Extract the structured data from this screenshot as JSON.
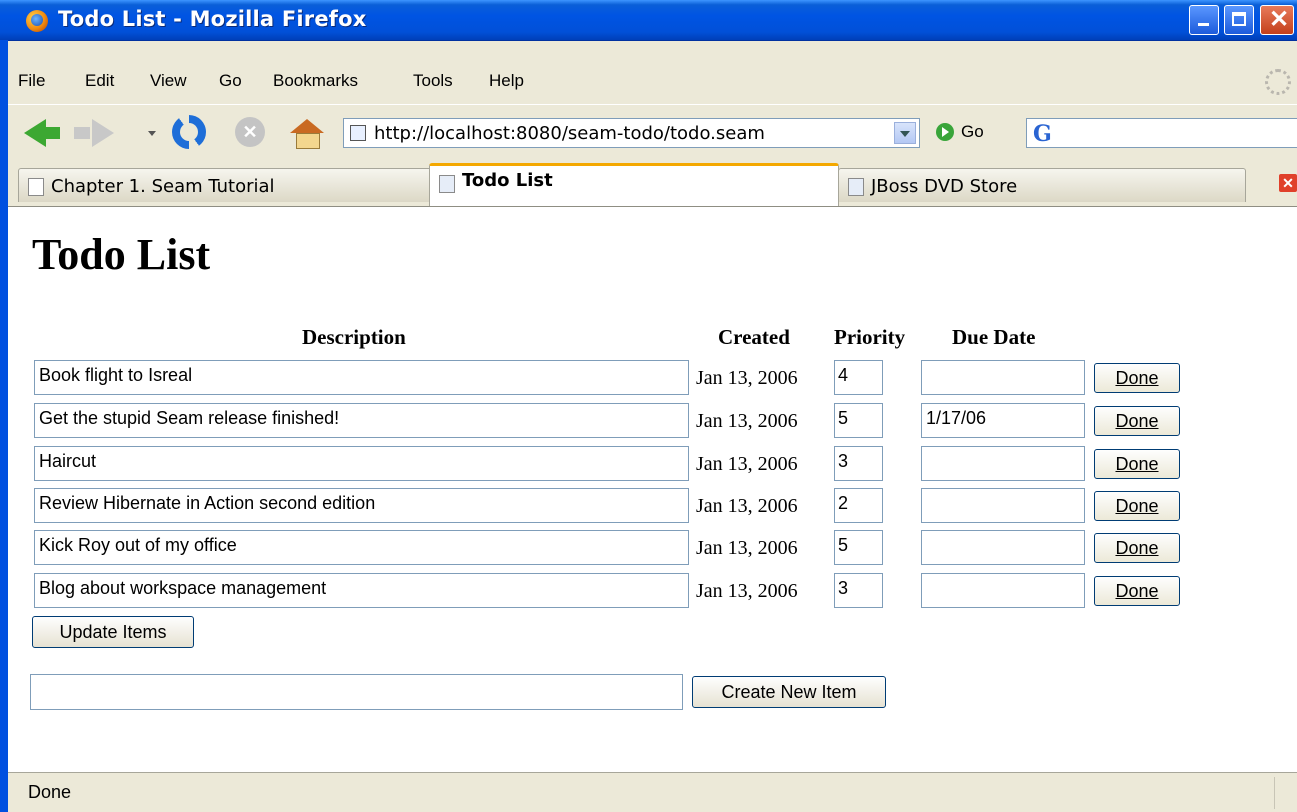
{
  "window": {
    "title": "Todo List - Mozilla Firefox"
  },
  "menu": [
    "File",
    "Edit",
    "View",
    "Go",
    "Bookmarks",
    "Tools",
    "Help"
  ],
  "nav": {
    "url": "http://localhost:8080/seam-todo/todo.seam",
    "go_label": "Go",
    "search_value": ""
  },
  "tabs": [
    {
      "label": "Chapter 1. Seam Tutorial",
      "active": false
    },
    {
      "label": "Todo List",
      "active": true
    },
    {
      "label": "JBoss DVD Store",
      "active": false
    }
  ],
  "page": {
    "title": "Todo List",
    "headers": {
      "description": "Description",
      "created": "Created",
      "priority": "Priority",
      "due_date": "Due Date"
    },
    "items": [
      {
        "description": "Book flight to Isreal",
        "created": "Jan 13, 2006",
        "priority": "4",
        "due_date": "",
        "action": "Done"
      },
      {
        "description": "Get the stupid Seam release finished!",
        "created": "Jan 13, 2006",
        "priority": "5",
        "due_date": "1/17/06",
        "action": "Done"
      },
      {
        "description": "Haircut",
        "created": "Jan 13, 2006",
        "priority": "3",
        "due_date": "",
        "action": "Done"
      },
      {
        "description": "Review Hibernate in Action second edition",
        "created": "Jan 13, 2006",
        "priority": "2",
        "due_date": "",
        "action": "Done"
      },
      {
        "description": "Kick Roy out of my office",
        "created": "Jan 13, 2006",
        "priority": "5",
        "due_date": "",
        "action": "Done"
      },
      {
        "description": "Blog about workspace management",
        "created": "Jan 13, 2006",
        "priority": "3",
        "due_date": "",
        "action": "Done"
      }
    ],
    "update_label": "Update Items",
    "new_item_value": "",
    "create_label": "Create New Item"
  },
  "status": "Done"
}
